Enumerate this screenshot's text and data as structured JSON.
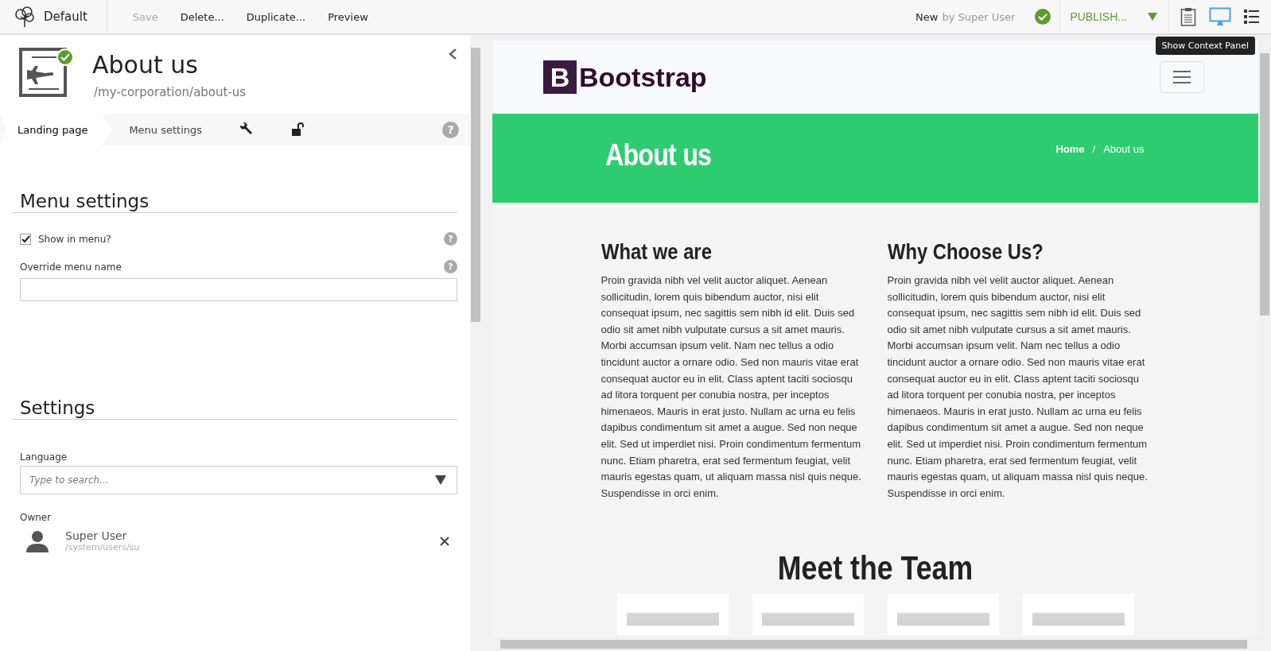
{
  "topbar": {
    "app_name": "Default",
    "actions": [
      {
        "label": "Save",
        "disabled": true
      },
      {
        "label": "Delete...",
        "disabled": false
      },
      {
        "label": "Duplicate...",
        "disabled": false
      },
      {
        "label": "Preview",
        "disabled": false
      }
    ],
    "status": "New",
    "status_by": "by Super User",
    "publish": "PUBLISH...",
    "tooltip": "Show Context Panel"
  },
  "page": {
    "title": "About us",
    "path": "/my-corporation/about-us"
  },
  "tabs": [
    {
      "kind": "text",
      "label": "Landing page",
      "selected": true
    },
    {
      "kind": "text",
      "label": "Menu settings",
      "selected": false
    },
    {
      "kind": "wrench",
      "selected": false
    },
    {
      "kind": "lock",
      "selected": false
    }
  ],
  "tabs_help": "?",
  "menu_settings": {
    "heading": "Menu settings",
    "show_in_menu": {
      "label": "Show in menu?",
      "checked": true,
      "help": "?"
    },
    "override_label": "Override menu name",
    "override_help": "?"
  },
  "settings": {
    "heading": "Settings",
    "language_label": "Language",
    "language_placeholder": "Type to search...",
    "owner_label": "Owner",
    "owner_name": "Super User",
    "owner_path": "/system/users/su"
  },
  "preview": {
    "logo_letter": "B",
    "logo_text": "Bootstrap",
    "banner_title": "About us",
    "breadcrumb_separator": "/",
    "breadcrumb": [
      {
        "label": "Home",
        "current": false
      },
      {
        "label": "About us",
        "current": true
      }
    ],
    "columns": [
      {
        "heading": "What we are",
        "text": "Proin gravida nibh vel velit auctor aliquet. Aenean sollicitudin, lorem quis bibendum auctor, nisi elit consequat ipsum, nec sagittis sem nibh id elit. Duis sed odio sit amet nibh vulputate cursus a sit amet mauris. Morbi accumsan ipsum velit. Nam nec tellus a odio tincidunt auctor a ornare odio. Sed non mauris vitae erat consequat auctor eu in elit. Class aptent taciti sociosqu ad litora torquent per conubia nostra, per inceptos himenaeos. Mauris in erat justo. Nullam ac urna eu felis dapibus condimentum sit amet a augue. Sed non neque elit. Sed ut imperdiet nisi. Proin condimentum fermentum nunc. Etiam pharetra, erat sed fermentum feugiat, velit mauris egestas quam, ut aliquam massa nisl quis neque. Suspendisse in orci enim."
      },
      {
        "heading": "Why Choose Us?",
        "text": "Proin gravida nibh vel velit auctor aliquet. Aenean sollicitudin, lorem quis bibendum auctor, nisi elit consequat ipsum, nec sagittis sem nibh id elit. Duis sed odio sit amet nibh vulputate cursus a sit amet mauris. Morbi accumsan ipsum velit. Nam nec tellus a odio tincidunt auctor a ornare odio. Sed non mauris vitae erat consequat auctor eu in elit. Class aptent taciti sociosqu ad litora torquent per conubia nostra, per inceptos himenaeos. Mauris in erat justo. Nullam ac urna eu felis dapibus condimentum sit amet a augue. Sed non neque elit. Sed ut imperdiet nisi. Proin condimentum fermentum nunc. Etiam pharetra, erat sed fermentum feugiat, velit mauris egestas quam, ut aliquam massa nisl quis neque. Suspendisse in orci enim."
      }
    ],
    "team_heading": "Meet the Team"
  }
}
